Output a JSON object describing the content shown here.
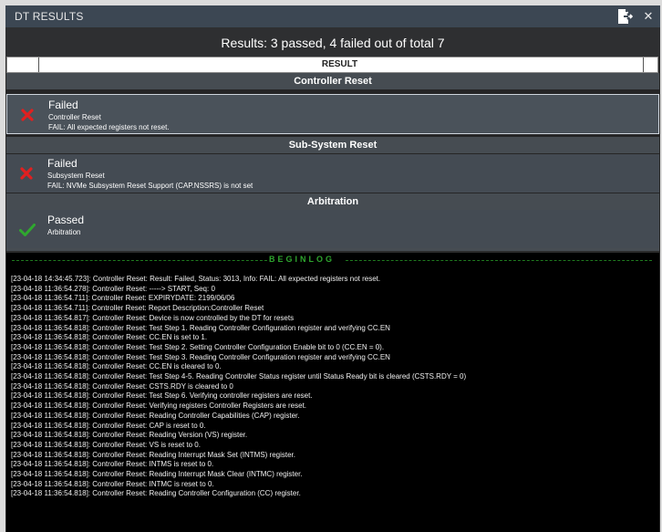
{
  "window": {
    "title": "DT RESULTS",
    "close_glyph": "✕",
    "export_icon": "export-icon",
    "close_icon": "close-icon"
  },
  "summary": "Results: 3 passed, 4 failed out of total 7",
  "table": {
    "column_header": "RESULT"
  },
  "groups": [
    {
      "header": "Controller Reset",
      "result": {
        "status": "Failed",
        "name": "Controller Reset",
        "info": "FAIL: All expected registers not reset.",
        "icon": "fail-x-icon",
        "selected": true
      }
    },
    {
      "header": "Sub-System Reset",
      "result": {
        "status": "Failed",
        "name": "Subsystem Reset",
        "info": "FAIL: NVMe Subsystem Reset Support (CAP.NSSRS) is not set",
        "icon": "fail-x-icon",
        "selected": false
      }
    },
    {
      "header": "Arbitration",
      "result": {
        "status": "Passed",
        "name": "Arbitration",
        "info": "",
        "icon": "pass-check-icon",
        "selected": false
      }
    }
  ],
  "colors": {
    "fail": "#e02020",
    "pass": "#2fa82f",
    "log_marker": "#2ea52e"
  },
  "log": {
    "begin_label": "BEGINLOG",
    "lines": [
      "[23-04-18 14:34:45.723]: Controller Reset: Result: Failed, Status: 3013, Info: FAIL: All expected registers not reset.",
      "[23-04-18 11:36:54.278]: Controller Reset: -----> START, Seq: 0",
      "[23-04-18 11:36:54.711]: Controller Reset: EXPIRYDATE: 2199/06/06",
      "[23-04-18 11:36:54.711]: Controller Reset: Report Description:Controller Reset",
      "[23-04-18 11:36:54.817]: Controller Reset: Device is now controlled by the DT for resets",
      "[23-04-18 11:36:54.818]: Controller Reset: Test Step 1. Reading Controller Configuration register and verifying CC.EN",
      "[23-04-18 11:36:54.818]: Controller Reset: CC.EN is set to 1.",
      "[23-04-18 11:36:54.818]: Controller Reset: Test Step 2. Setting Controller Configuration Enable bit to 0 (CC.EN = 0).",
      "[23-04-18 11:36:54.818]: Controller Reset: Test Step 3. Reading Controller Configuration register and verifying CC.EN",
      "[23-04-18 11:36:54.818]: Controller Reset: CC.EN is cleared to 0.",
      "[23-04-18 11:36:54.818]: Controller Reset: Test Step 4-5. Reading Controller Status register until Status Ready bit is cleared (CSTS.RDY = 0)",
      "[23-04-18 11:36:54.818]: Controller Reset: CSTS.RDY is cleared to 0",
      "[23-04-18 11:36:54.818]: Controller Reset: Test Step 6. Verifying controller registers are reset.",
      "[23-04-18 11:36:54.818]: Controller Reset: Verifying registers Controller Registers are reset.",
      "[23-04-18 11:36:54.818]: Controller Reset: Reading Controller Capabilities (CAP) register.",
      "[23-04-18 11:36:54.818]: Controller Reset: CAP is reset to 0.",
      "[23-04-18 11:36:54.818]: Controller Reset: Reading Version (VS) register.",
      "[23-04-18 11:36:54.818]: Controller Reset: VS is reset to 0.",
      "[23-04-18 11:36:54.818]: Controller Reset: Reading Interrupt Mask Set (INTMS) register.",
      "[23-04-18 11:36:54.818]: Controller Reset: INTMS is reset to 0.",
      "[23-04-18 11:36:54.818]: Controller Reset: Reading Interrupt Mask Clear (INTMC) register.",
      "[23-04-18 11:36:54.818]: Controller Reset: INTMC is reset to 0.",
      "[23-04-18 11:36:54.818]: Controller Reset: Reading Controller Configuration (CC) register."
    ]
  }
}
